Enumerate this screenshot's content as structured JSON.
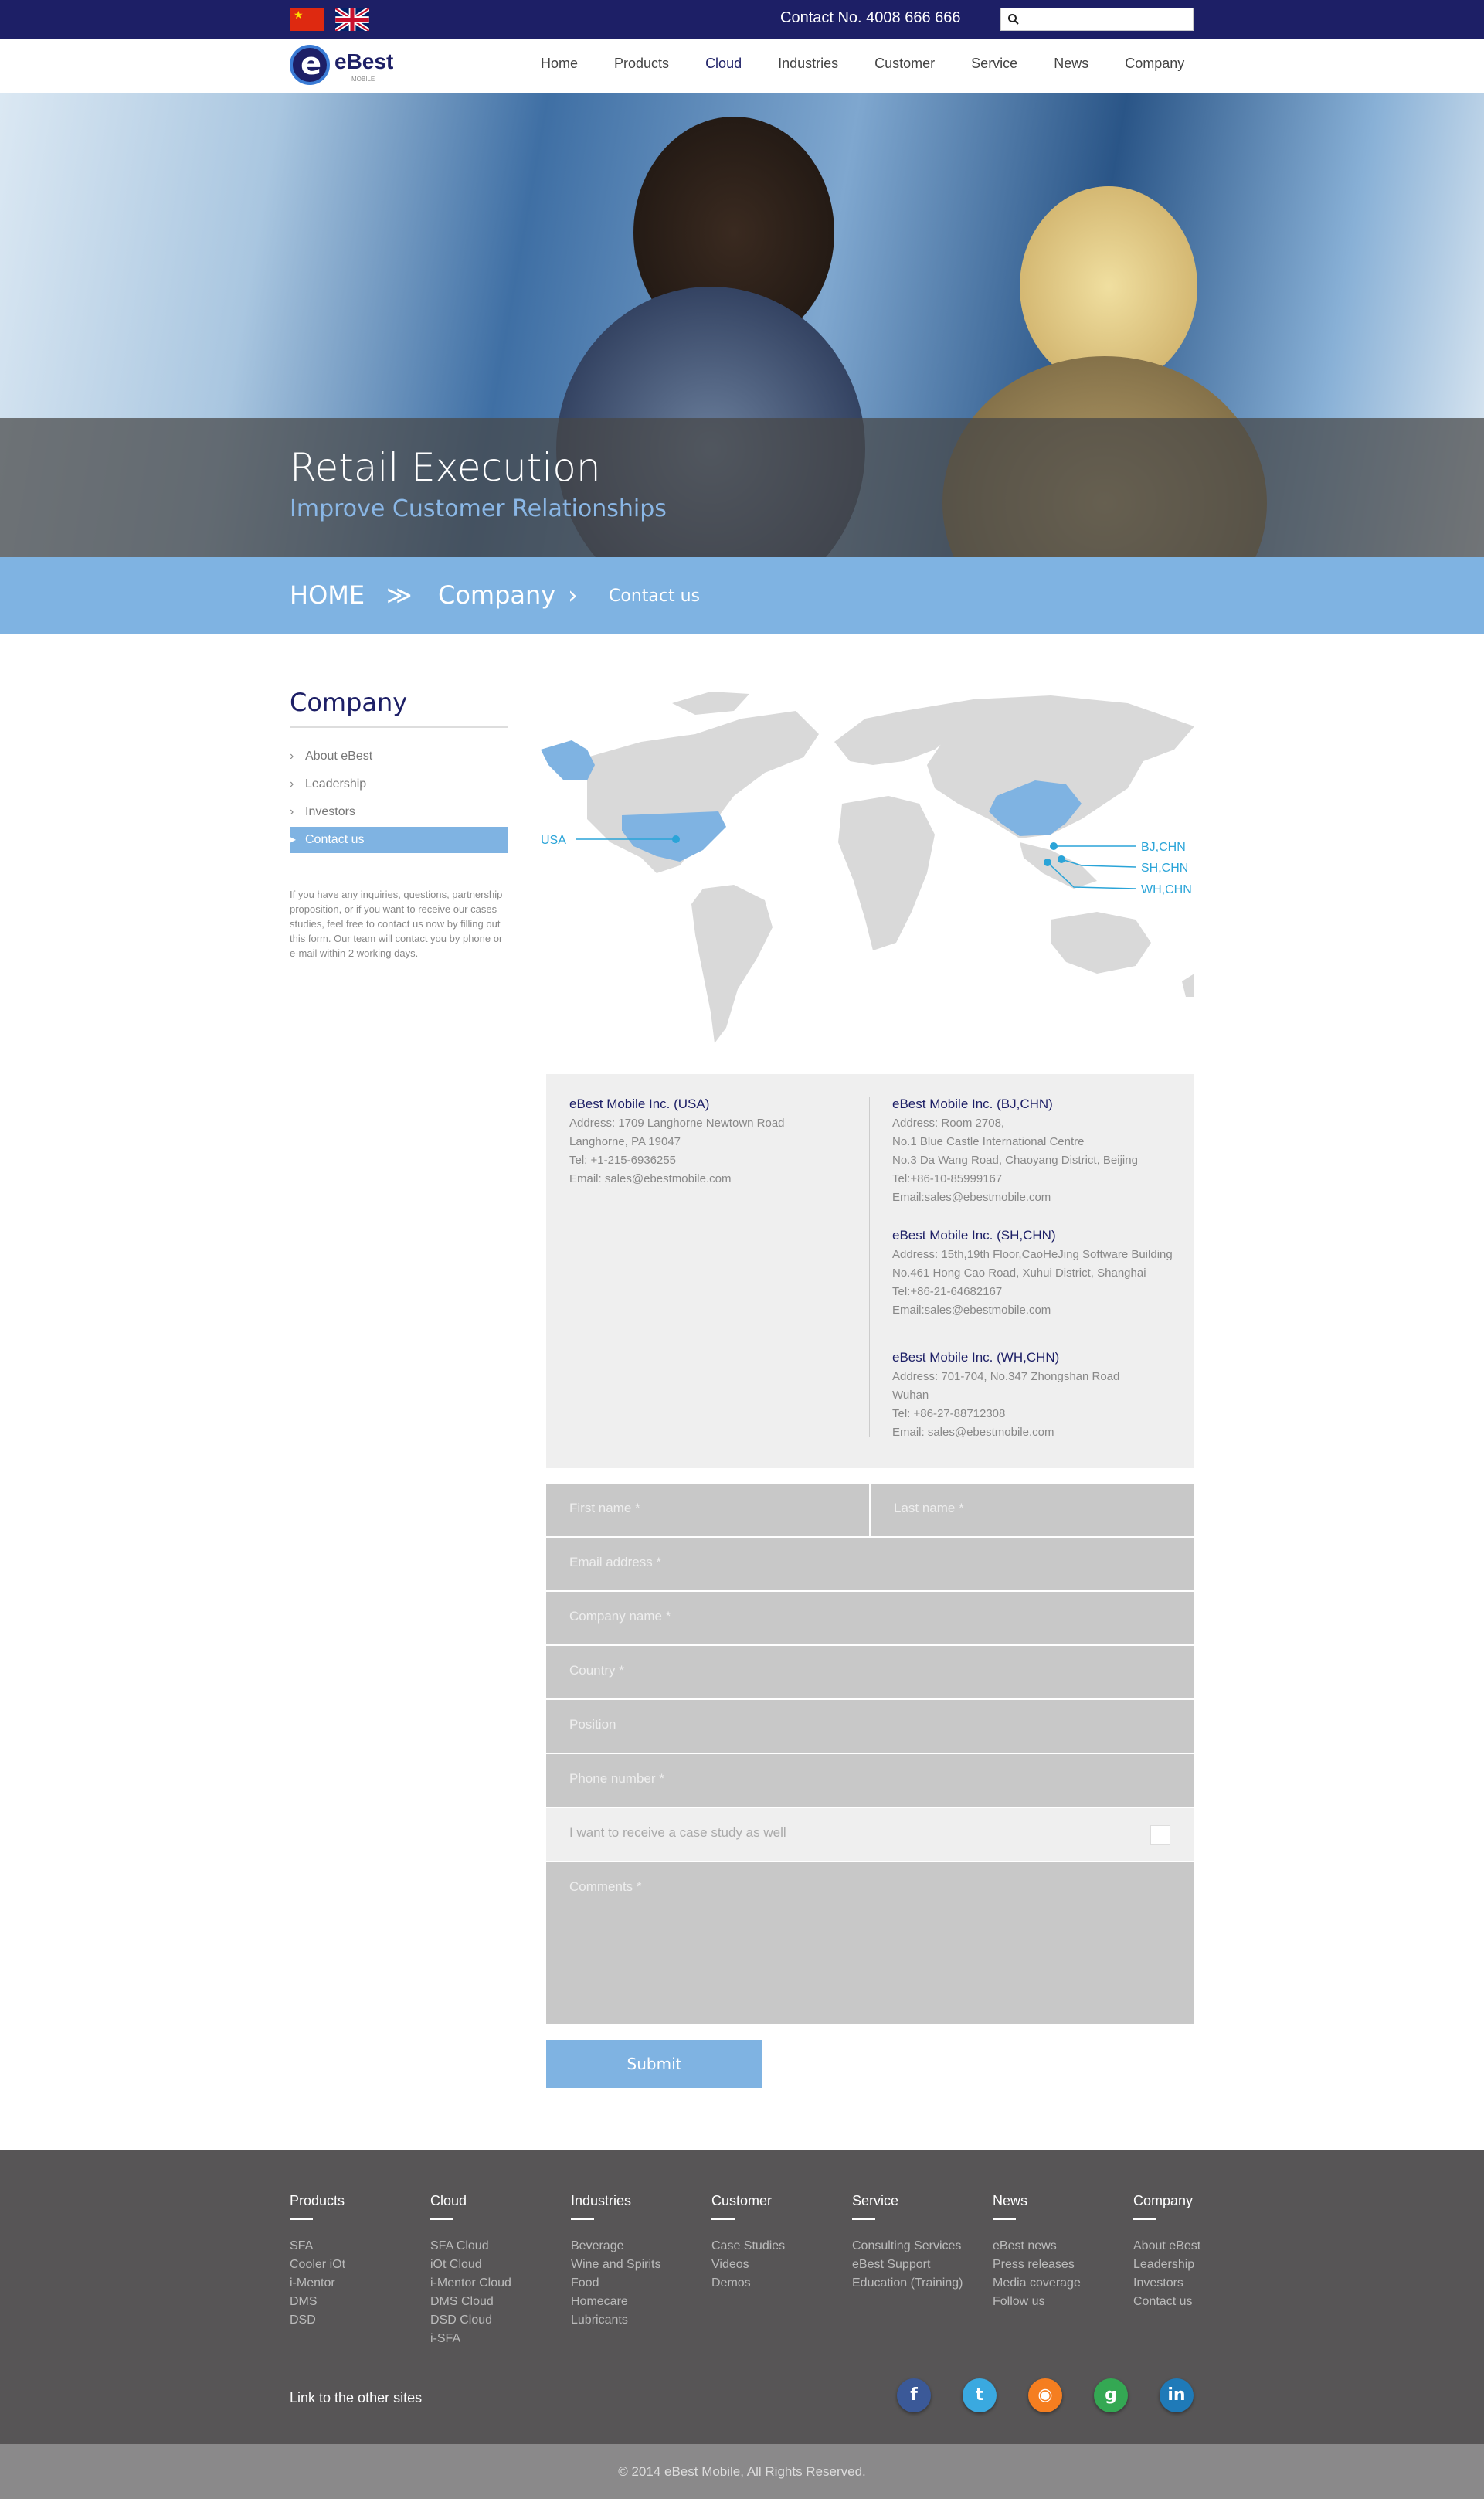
{
  "topbar": {
    "contact_label": "Contact No.  4008 666 666",
    "search_placeholder": "",
    "flags": [
      "china-flag",
      "uk-flag"
    ]
  },
  "logo": {
    "name": "eBest",
    "sub": "MOBILE",
    "mark": "e"
  },
  "nav": {
    "items": [
      "Home",
      "Products",
      "Cloud",
      "Industries",
      "Customer",
      "Service",
      "News",
      "Company"
    ],
    "active": "Cloud"
  },
  "hero": {
    "title": "Retail Execution",
    "subtitle": "Improve Customer Relationships"
  },
  "breadcrumb": {
    "home": "HOME",
    "sep1": "≫",
    "section": "Company",
    "sep2": "›",
    "page": "Contact us"
  },
  "sidebar": {
    "title": "Company",
    "items": [
      "About eBest",
      "Leadership",
      "Investors",
      "Contact us"
    ],
    "active": "Contact us",
    "note": "If you have any inquiries, questions, partnership proposition, or if you want to receive our cases studies, feel free to contact us now by filling out this form. Our team will contact you by phone or e-mail within 2 working days."
  },
  "map": {
    "labels": [
      "USA",
      "BJ,CHN",
      "SH,CHN",
      "WH,CHN"
    ],
    "highlight_color": "#7fb3e2",
    "marker_color": "#2aa4d8"
  },
  "offices": [
    {
      "name": "eBest Mobile Inc. (USA)",
      "lines": [
        "Address: 1709 Langhorne Newtown Road",
        "Langhorne, PA 19047",
        "Tel: +1-215-6936255",
        "Email: sales@ebestmobile.com"
      ]
    },
    {
      "name": "eBest Mobile Inc. (BJ,CHN)",
      "lines": [
        "Address: Room 2708,",
        "No.1 Blue Castle International Centre",
        "No.3 Da Wang Road, Chaoyang District, Beijing",
        "Tel:+86-10-85999167",
        "Email:sales@ebestmobile.com"
      ]
    },
    {
      "name": "eBest Mobile Inc. (SH,CHN)",
      "lines": [
        "Address: 15th,19th Floor,CaoHeJing Software Building",
        "No.461 Hong Cao Road, Xuhui District, Shanghai",
        "Tel:+86-21-64682167",
        "Email:sales@ebestmobile.com"
      ]
    },
    {
      "name": "eBest Mobile Inc. (WH,CHN)",
      "lines": [
        "Address: 701-704, No.347 Zhongshan Road",
        "Wuhan",
        "Tel: +86-27-88712308",
        "Email: sales@ebestmobile.com"
      ]
    }
  ],
  "form": {
    "first_name": "First name *",
    "last_name": "Last name *",
    "email": "Email address *",
    "company": "Company name *",
    "country": "Country *",
    "position": "Position",
    "phone": "Phone number *",
    "case_study": "I want to receive a case study as well",
    "comments": "Comments *",
    "submit": "Submit"
  },
  "footer": {
    "columns": [
      {
        "title": "Products",
        "links": [
          "SFA",
          "Cooler iOt",
          "i-Mentor",
          "DMS",
          "DSD"
        ]
      },
      {
        "title": "Cloud",
        "links": [
          "SFA Cloud",
          "iOt Cloud",
          "i-Mentor Cloud",
          "DMS Cloud",
          "DSD Cloud",
          "i-SFA"
        ]
      },
      {
        "title": "Industries",
        "links": [
          "Beverage",
          "Wine and Spirits",
          "Food",
          "Homecare",
          "Lubricants"
        ]
      },
      {
        "title": "Customer",
        "links": [
          "Case Studies",
          "Videos",
          "Demos"
        ]
      },
      {
        "title": "Service",
        "links": [
          "Consulting Services",
          "eBest  Support",
          "Education (Training)"
        ]
      },
      {
        "title": "News",
        "links": [
          "eBest news",
          "Press releases",
          "Media coverage",
          "Follow us"
        ]
      },
      {
        "title": "Company",
        "links": [
          "About eBest",
          "Leadership",
          "Investors",
          "Contact us"
        ]
      }
    ],
    "other_sites": "Link to the other sites",
    "social": [
      {
        "icon": "facebook-icon",
        "glyph": "f",
        "color": "#3b5998"
      },
      {
        "icon": "twitter-icon",
        "glyph": "t",
        "color": "#3aa9e0"
      },
      {
        "icon": "rss-icon",
        "glyph": "◉",
        "color": "#f57e20"
      },
      {
        "icon": "google-icon",
        "glyph": "g",
        "color": "#34a853"
      },
      {
        "icon": "linkedin-icon",
        "glyph": "in",
        "color": "#1f7ab8"
      }
    ],
    "copyright": "© 2014 eBest Mobile, All Rights Reserved."
  }
}
